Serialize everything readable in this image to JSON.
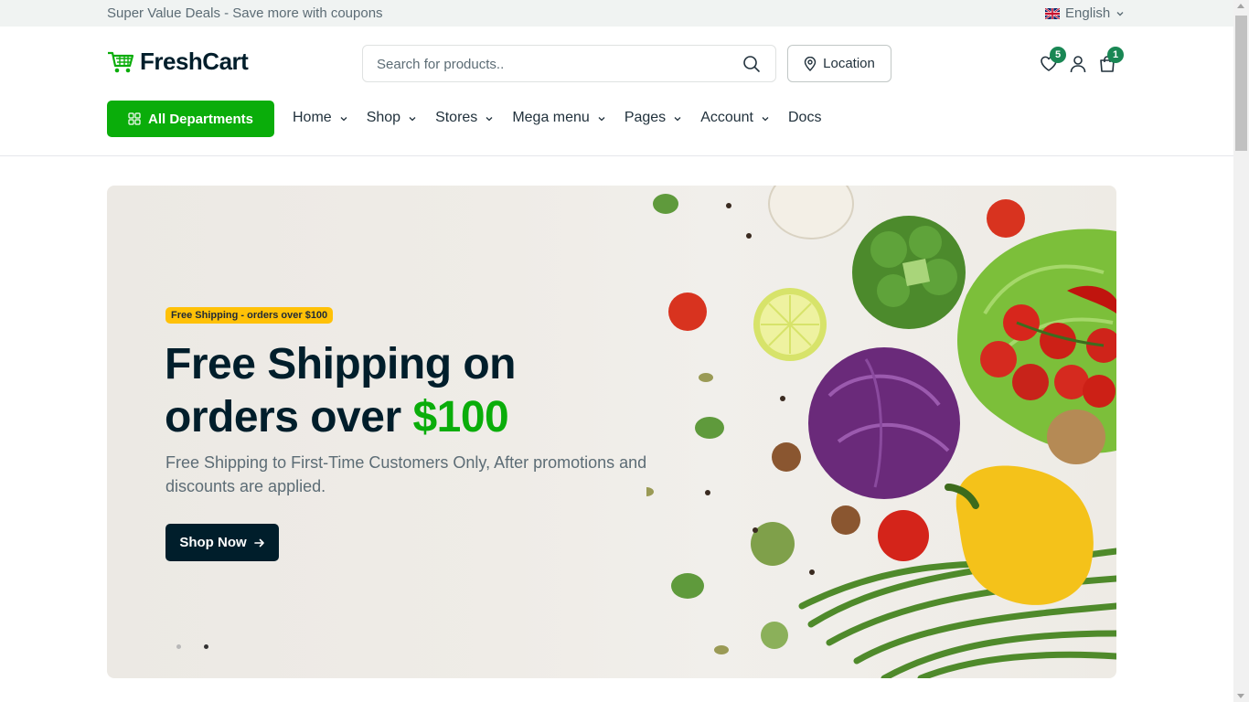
{
  "topbar": {
    "promo": "Super Value Deals - Save more with coupons",
    "language": "English"
  },
  "header": {
    "logo_text": "FreshCart",
    "search_placeholder": "Search for products..",
    "location_label": "Location",
    "wishlist_count": "5",
    "cart_count": "1"
  },
  "nav": {
    "departments_label": "All Departments",
    "items": [
      {
        "label": "Home",
        "has_dropdown": true
      },
      {
        "label": "Shop",
        "has_dropdown": true
      },
      {
        "label": "Stores",
        "has_dropdown": true
      },
      {
        "label": "Mega menu",
        "has_dropdown": true
      },
      {
        "label": "Pages",
        "has_dropdown": true
      },
      {
        "label": "Account",
        "has_dropdown": true
      },
      {
        "label": "Docs",
        "has_dropdown": false
      }
    ]
  },
  "hero": {
    "badge": "Free Shipping - orders over $100",
    "title_line1": "Free Shipping on",
    "title_line2_prefix": "orders over ",
    "title_line2_accent": "$100",
    "description": "Free Shipping to First-Time Customers Only, After promotions and discounts are applied.",
    "cta_label": "Shop Now",
    "slides_count": 2,
    "active_slide": 2
  },
  "colors": {
    "brand_green": "#0aad0a",
    "dark_navy": "#001e2b",
    "badge_yellow": "#ffc107",
    "muted_text": "#5c6c75"
  },
  "icons": [
    "shopping-cart-logo-icon",
    "search-icon",
    "map-pin-icon",
    "heart-icon",
    "user-icon",
    "shopping-bag-icon",
    "grid-icon",
    "chevron-down-icon",
    "arrow-right-icon",
    "uk-flag-icon"
  ]
}
